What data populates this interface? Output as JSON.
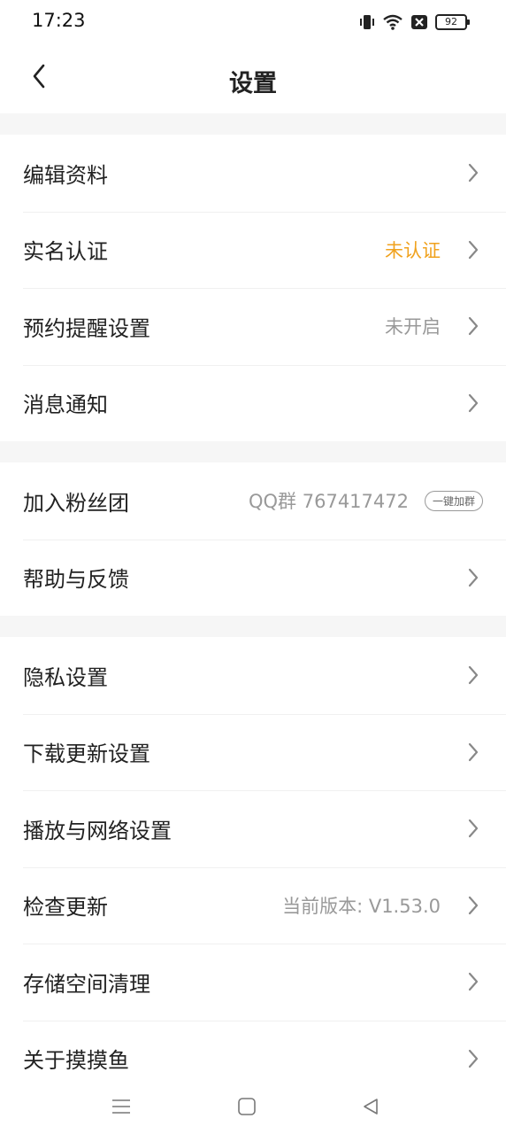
{
  "status_bar": {
    "time": "17:23",
    "battery": "92",
    "icons": [
      "vibrate-icon",
      "wifi-icon",
      "sim-blocked-icon",
      "battery-icon"
    ]
  },
  "header": {
    "title": "设置",
    "back_icon": "chevron-left-icon"
  },
  "groups": {
    "profile": {
      "edit_profile": {
        "label": "编辑资料"
      },
      "real_name": {
        "label": "实名认证",
        "value": "未认证"
      },
      "reminder": {
        "label": "预约提醒设置",
        "value": "未开启"
      },
      "notifications": {
        "label": "消息通知"
      }
    },
    "community": {
      "fan_club": {
        "label": "加入粉丝团",
        "value": "QQ群 767417472",
        "button": "一键加群"
      },
      "help": {
        "label": "帮助与反馈"
      }
    },
    "system": {
      "privacy": {
        "label": "隐私设置"
      },
      "download": {
        "label": "下载更新设置"
      },
      "playback": {
        "label": "播放与网络设置"
      },
      "check_update": {
        "label": "检查更新",
        "value": "当前版本: V1.53.0"
      },
      "storage": {
        "label": "存储空间清理"
      },
      "about": {
        "label": "关于摸摸鱼"
      }
    }
  },
  "nav_bar": {
    "icons": [
      "menu-icon",
      "home-icon",
      "back-icon"
    ]
  },
  "colors": {
    "warning": "#f0a21e",
    "secondary_text": "#999999",
    "section_gap": "#f6f6f6"
  }
}
